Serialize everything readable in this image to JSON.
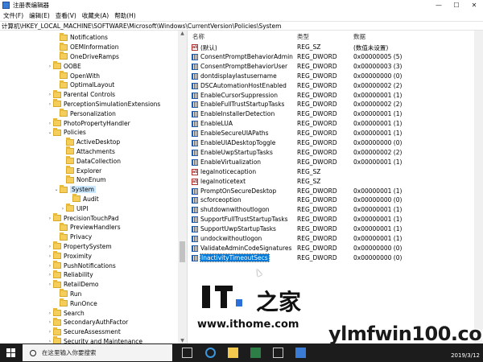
{
  "window": {
    "title": "注册表编辑器",
    "controls": [
      "—",
      "☐",
      "✕"
    ]
  },
  "menu": [
    "文件(F)",
    "编辑(E)",
    "查看(V)",
    "收藏夹(A)",
    "帮助(H)"
  ],
  "address": "计算机\\HKEY_LOCAL_MACHINE\\SOFTWARE\\Microsoft\\Windows\\CurrentVersion\\Policies\\System",
  "tree": [
    {
      "label": "Notifications",
      "chevron": ""
    },
    {
      "label": "OEMInformation",
      "chevron": ""
    },
    {
      "label": "OneDriveRamps",
      "chevron": ""
    },
    {
      "label": "OOBE",
      "chevron": "›"
    },
    {
      "label": "OpenWith",
      "chevron": ""
    },
    {
      "label": "OptimalLayout",
      "chevron": ""
    },
    {
      "label": "Parental Controls",
      "chevron": "›"
    },
    {
      "label": "PerceptionSimulationExtensions",
      "chevron": "›"
    },
    {
      "label": "Personalization",
      "chevron": ""
    },
    {
      "label": "PhotoPropertyHandler",
      "chevron": "›"
    },
    {
      "label": "Policies",
      "chevron": "⌄"
    },
    {
      "label": "ActiveDesktop",
      "chevron": ""
    },
    {
      "label": "Attachments",
      "chevron": ""
    },
    {
      "label": "DataCollection",
      "chevron": ""
    },
    {
      "label": "Explorer",
      "chevron": ""
    },
    {
      "label": "NonEnum",
      "chevron": ""
    },
    {
      "label": "System",
      "chevron": "⌄"
    },
    {
      "label": "Audit",
      "chevron": ""
    },
    {
      "label": "UIPI",
      "chevron": "›"
    },
    {
      "label": "PrecisionTouchPad",
      "chevron": "›"
    },
    {
      "label": "PreviewHandlers",
      "chevron": ""
    },
    {
      "label": "Privacy",
      "chevron": ""
    },
    {
      "label": "PropertySystem",
      "chevron": "›"
    },
    {
      "label": "Proximity",
      "chevron": "›"
    },
    {
      "label": "PushNotifications",
      "chevron": "›"
    },
    {
      "label": "Reliability",
      "chevron": "›"
    },
    {
      "label": "RetailDemo",
      "chevron": "›"
    },
    {
      "label": "Run",
      "chevron": ""
    },
    {
      "label": "RunOnce",
      "chevron": ""
    },
    {
      "label": "Search",
      "chevron": "›"
    },
    {
      "label": "SecondaryAuthFactor",
      "chevron": "›"
    },
    {
      "label": "SecureAssessment",
      "chevron": "›"
    },
    {
      "label": "Security and Maintenance",
      "chevron": "›"
    }
  ],
  "list": {
    "headers": {
      "name": "名称",
      "type": "类型",
      "data": "数据"
    },
    "rows": [
      {
        "icon": "string-value-icon",
        "name": "(默认)",
        "type": "REG_SZ",
        "data": "(数值未设置)"
      },
      {
        "icon": "dword-value-icon",
        "name": "ConsentPromptBehaviorAdmin",
        "type": "REG_DWORD",
        "data": "0x00000005 (5)"
      },
      {
        "icon": "dword-value-icon",
        "name": "ConsentPromptBehaviorUser",
        "type": "REG_DWORD",
        "data": "0x00000003 (3)"
      },
      {
        "icon": "dword-value-icon",
        "name": "dontdisplaylastusername",
        "type": "REG_DWORD",
        "data": "0x00000000 (0)"
      },
      {
        "icon": "dword-value-icon",
        "name": "DSCAutomationHostEnabled",
        "type": "REG_DWORD",
        "data": "0x00000002 (2)"
      },
      {
        "icon": "dword-value-icon",
        "name": "EnableCursorSuppression",
        "type": "REG_DWORD",
        "data": "0x00000001 (1)"
      },
      {
        "icon": "dword-value-icon",
        "name": "EnableFullTrustStartupTasks",
        "type": "REG_DWORD",
        "data": "0x00000002 (2)"
      },
      {
        "icon": "dword-value-icon",
        "name": "EnableInstallerDetection",
        "type": "REG_DWORD",
        "data": "0x00000001 (1)"
      },
      {
        "icon": "dword-value-icon",
        "name": "EnableLUA",
        "type": "REG_DWORD",
        "data": "0x00000001 (1)"
      },
      {
        "icon": "dword-value-icon",
        "name": "EnableSecureUIAPaths",
        "type": "REG_DWORD",
        "data": "0x00000001 (1)"
      },
      {
        "icon": "dword-value-icon",
        "name": "EnableUIADesktopToggle",
        "type": "REG_DWORD",
        "data": "0x00000000 (0)"
      },
      {
        "icon": "dword-value-icon",
        "name": "EnableUwpStartupTasks",
        "type": "REG_DWORD",
        "data": "0x00000002 (2)"
      },
      {
        "icon": "dword-value-icon",
        "name": "EnableVirtualization",
        "type": "REG_DWORD",
        "data": "0x00000001 (1)"
      },
      {
        "icon": "string-value-icon",
        "name": "legalnoticecaption",
        "type": "REG_SZ",
        "data": ""
      },
      {
        "icon": "string-value-icon",
        "name": "legalnoticetext",
        "type": "REG_SZ",
        "data": ""
      },
      {
        "icon": "dword-value-icon",
        "name": "PromptOnSecureDesktop",
        "type": "REG_DWORD",
        "data": "0x00000001 (1)"
      },
      {
        "icon": "dword-value-icon",
        "name": "scforceoption",
        "type": "REG_DWORD",
        "data": "0x00000000 (0)"
      },
      {
        "icon": "dword-value-icon",
        "name": "shutdownwithoutlogon",
        "type": "REG_DWORD",
        "data": "0x00000001 (1)"
      },
      {
        "icon": "dword-value-icon",
        "name": "SupportFullTrustStartupTasks",
        "type": "REG_DWORD",
        "data": "0x00000001 (1)"
      },
      {
        "icon": "dword-value-icon",
        "name": "SupportUwpStartupTasks",
        "type": "REG_DWORD",
        "data": "0x00000001 (1)"
      },
      {
        "icon": "dword-value-icon",
        "name": "undockwithoutlogon",
        "type": "REG_DWORD",
        "data": "0x00000001 (1)"
      },
      {
        "icon": "dword-value-icon",
        "name": "ValidateAdminCodeSignatures",
        "type": "REG_DWORD",
        "data": "0x00000000 (0)"
      },
      {
        "icon": "dword-value-icon",
        "name": "InactivityTimeoutSecs",
        "type": "REG_DWORD",
        "data": "0x00000000 (0)"
      }
    ]
  },
  "watermark": {
    "site_url": "www.ithome.com",
    "brand": "ylmfwin100.com"
  },
  "taskbar": {
    "search_placeholder": "在这里输入你要搜索",
    "date": "2019/3/12"
  },
  "colors": {
    "selection": "#0078d7",
    "tree_selection": "#cce8ff",
    "taskbar": "#1c1c1c"
  }
}
